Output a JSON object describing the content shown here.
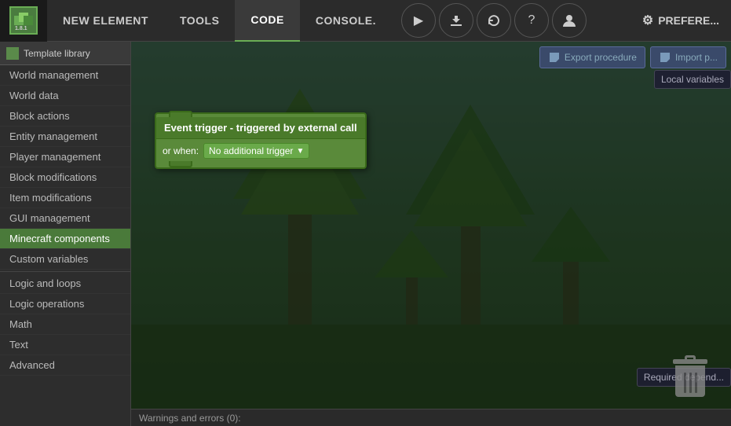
{
  "navbar": {
    "logo_text": "1.8.1",
    "buttons": [
      {
        "label": "NEW ELEMENT",
        "active": false
      },
      {
        "label": "TOOLS",
        "active": false
      },
      {
        "label": "CODE",
        "active": true
      },
      {
        "label": "CONSOLE.",
        "active": false
      }
    ],
    "icon_buttons": [
      {
        "name": "play",
        "symbol": "▶"
      },
      {
        "name": "download",
        "symbol": "⬇"
      },
      {
        "name": "refresh",
        "symbol": "↻"
      },
      {
        "name": "help",
        "symbol": "?"
      },
      {
        "name": "account",
        "symbol": "👤"
      }
    ],
    "prefs_label": "PREFERE..."
  },
  "sidebar": {
    "template_library_label": "Template library",
    "items": [
      {
        "label": "World management",
        "active": false
      },
      {
        "label": "World data",
        "active": false
      },
      {
        "label": "Block actions",
        "active": false
      },
      {
        "label": "Entity management",
        "active": false
      },
      {
        "label": "Player management",
        "active": false
      },
      {
        "label": "Block modifications",
        "active": false
      },
      {
        "label": "Item modifications",
        "active": false
      },
      {
        "label": "GUI management",
        "active": false
      },
      {
        "label": "Minecraft components",
        "active": true
      },
      {
        "label": "Custom variables",
        "active": false
      },
      {
        "label": "Logic and loops",
        "active": false
      },
      {
        "label": "Logic operations",
        "active": false
      },
      {
        "label": "Math",
        "active": false
      },
      {
        "label": "Text",
        "active": false
      },
      {
        "label": "Advanced",
        "active": false
      }
    ]
  },
  "canvas": {
    "export_procedure_label": "Export procedure",
    "import_label": "Import p...",
    "local_variables_label": "Local variables",
    "required_depends_label": "Required depend...",
    "event_block": {
      "title": "Event trigger - triggered by external call",
      "or_when_label": "or when:",
      "dropdown_value": "No additional trigger",
      "dropdown_arrow": "▼"
    },
    "trash_tooltip": "Delete"
  },
  "warnings_bar": {
    "label": "Warnings and errors (0):"
  }
}
